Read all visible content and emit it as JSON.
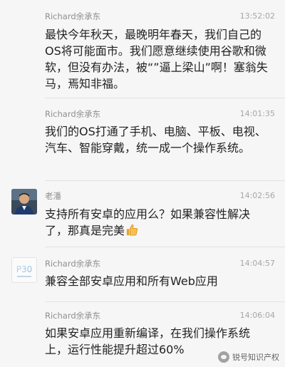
{
  "messages": [
    {
      "sender": "Richard余承东",
      "time": "13:52:02",
      "avatar": "none",
      "text": "最快今年秋天，最晚明年春天，我们自己的OS将可能面市。我们愿意继续使用谷歌和微软，但没有办法，被“”逼上梁山”啊！塞翁失马，焉知非福。"
    },
    {
      "sender": "Richard余承东",
      "time": "14:01:35",
      "avatar": "none",
      "text": "我们的OS打通了手机、电脑、平板、电视、汽车、智能穿戴，统一成一个操作系统。"
    },
    {
      "sender": "老潘",
      "time": "14:02:56",
      "avatar": "person-photo",
      "text": "支持所有安卓的应用么？如果兼容性解决了，那真是完美",
      "emoji": "thumbs-up-icon"
    },
    {
      "sender": "Richard余承东",
      "time": "14:04:57",
      "avatar": "p30-logo",
      "avatar_text": "P30",
      "text": "兼容全部安卓应用和所有Web应用"
    },
    {
      "sender": "Richard余承东",
      "time": "14:06:04",
      "avatar": "none",
      "text": "如果安卓应用重新编译，在我们操作系统上，运行性能提升超过60%"
    }
  ],
  "watermark": {
    "text": "锐号知识产权",
    "icon": "wechat-logo-icon"
  },
  "colors": {
    "background": "#f6f6f6",
    "name": "#8e8e8e",
    "time": "#a6a6a6",
    "text": "#222222",
    "separator": "#e2e2e2"
  }
}
